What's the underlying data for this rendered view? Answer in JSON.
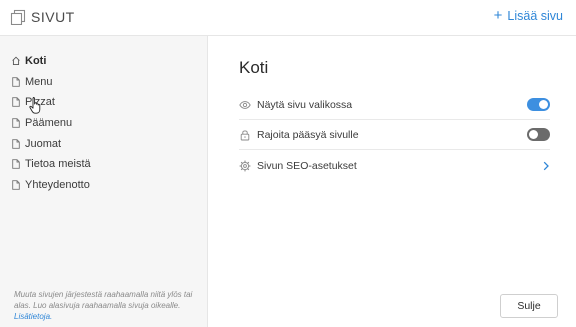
{
  "header": {
    "title": "SIVUT",
    "add_page_label": "Lisää sivu"
  },
  "sidebar": {
    "items": [
      {
        "label": "Koti",
        "icon": "home-icon",
        "active": true
      },
      {
        "label": "Menu",
        "icon": "page-icon"
      },
      {
        "label": "Pizzat",
        "icon": "page-icon"
      },
      {
        "label": "Päämenu",
        "icon": "page-icon"
      },
      {
        "label": "Juomat",
        "icon": "page-icon"
      },
      {
        "label": "Tietoa meistä",
        "icon": "page-icon"
      },
      {
        "label": "Yhteydenotto",
        "icon": "page-icon"
      }
    ],
    "hint_text": "Muuta sivujen järjestestä raahaamalla niitä ylös tai alas. Luo alasivuja raahaamalla sivuja oikealle.",
    "hint_link": "Lisätietoja."
  },
  "main": {
    "title": "Koti",
    "settings": [
      {
        "label": "Näytä sivu valikossa",
        "icon": "eye-icon",
        "control": "toggle",
        "value": true
      },
      {
        "label": "Rajoita pääsyä sivulle",
        "icon": "lock-icon",
        "control": "toggle",
        "value": false
      },
      {
        "label": "Sivun SEO-asetukset",
        "icon": "gear-icon",
        "control": "chevron"
      }
    ],
    "close_label": "Sulje"
  },
  "colors": {
    "accent": "#3d8fe0",
    "link": "#2f86d7",
    "sidebar_bg": "#f6f6f6"
  }
}
